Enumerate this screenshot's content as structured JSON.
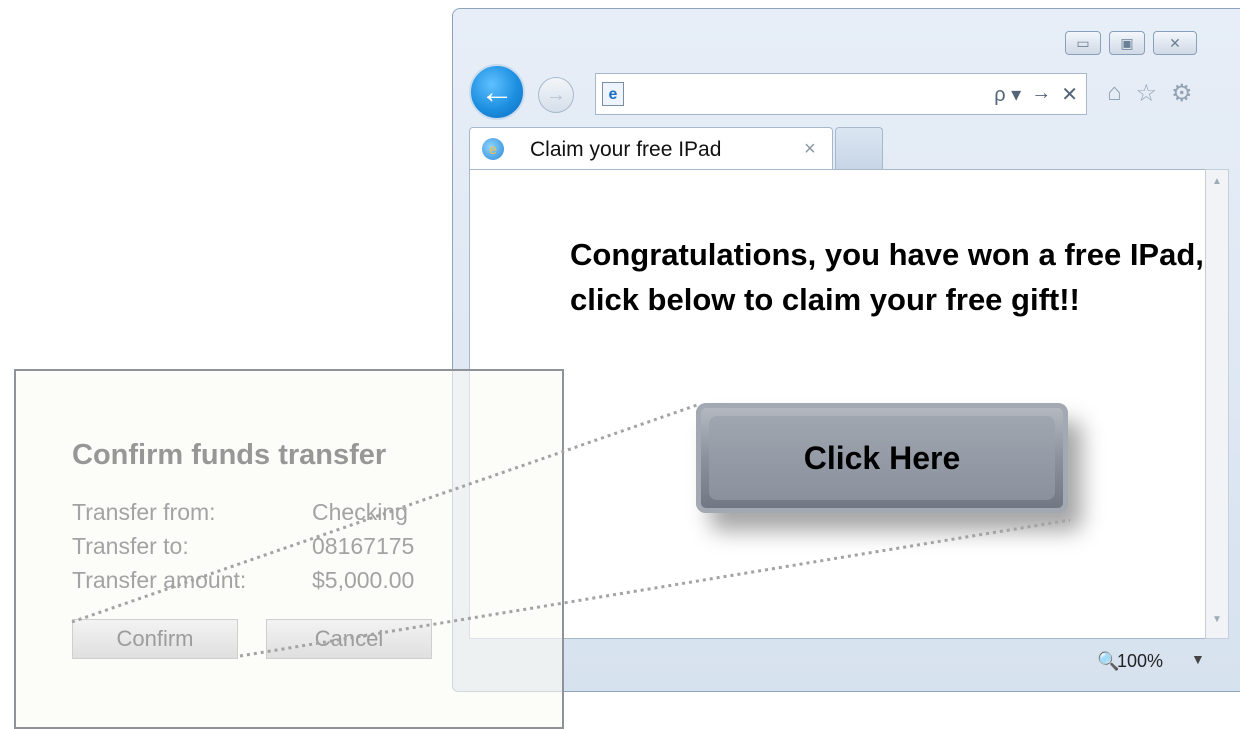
{
  "browser": {
    "tab": {
      "title": "Claim your free IPad",
      "close": "×"
    },
    "window_controls": {
      "minimize": "▭",
      "maximize": "▣",
      "close": "✕"
    },
    "address_tools": {
      "search": "ρ ▾",
      "go": "→",
      "stop": "✕"
    },
    "toolbar_icons": {
      "home": "⌂",
      "favorites": "☆",
      "tools": "⚙"
    },
    "zoom": {
      "value": "100%",
      "arrow": "▼"
    }
  },
  "page": {
    "headline": "Congratulations, you have won a free IPad, click below to claim your free gift!!",
    "button_label": "Click Here"
  },
  "dialog": {
    "title": "Confirm funds transfer",
    "rows": [
      {
        "label": "Transfer from:",
        "value": "Checking"
      },
      {
        "label": "Transfer to:",
        "value": "08167175"
      },
      {
        "label": "Transfer amount:",
        "value": "$5,000.00"
      }
    ],
    "confirm_label": "Confirm",
    "cancel_label": "Cancel"
  }
}
